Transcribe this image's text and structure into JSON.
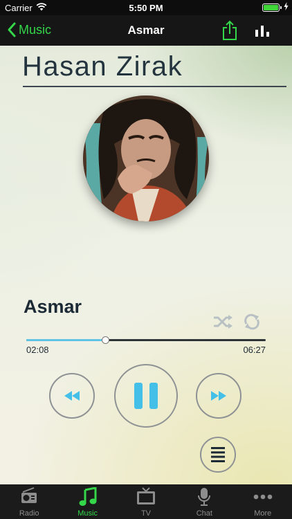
{
  "status_bar": {
    "carrier": "Carrier",
    "time": "5:50 PM"
  },
  "nav": {
    "back_label": "Music",
    "title": "Asmar"
  },
  "player": {
    "artist": "Hasan Zirak",
    "song_title": "Asmar",
    "elapsed": "02:08",
    "duration": "06:27",
    "progress_fraction": 0.33
  },
  "tabs": [
    {
      "label": "Radio",
      "icon": "radio-icon",
      "active": false
    },
    {
      "label": "Music",
      "icon": "music-note-icon",
      "active": true
    },
    {
      "label": "TV",
      "icon": "tv-icon",
      "active": false
    },
    {
      "label": "Chat",
      "icon": "microphone-icon",
      "active": false
    },
    {
      "label": "More",
      "icon": "more-dots-icon",
      "active": false
    }
  ],
  "colors": {
    "accent_green": "#34d64a",
    "progress_blue": "#5fc4e6",
    "control_icon_blue": "#43bfe8",
    "battery_green": "#41d63a"
  }
}
